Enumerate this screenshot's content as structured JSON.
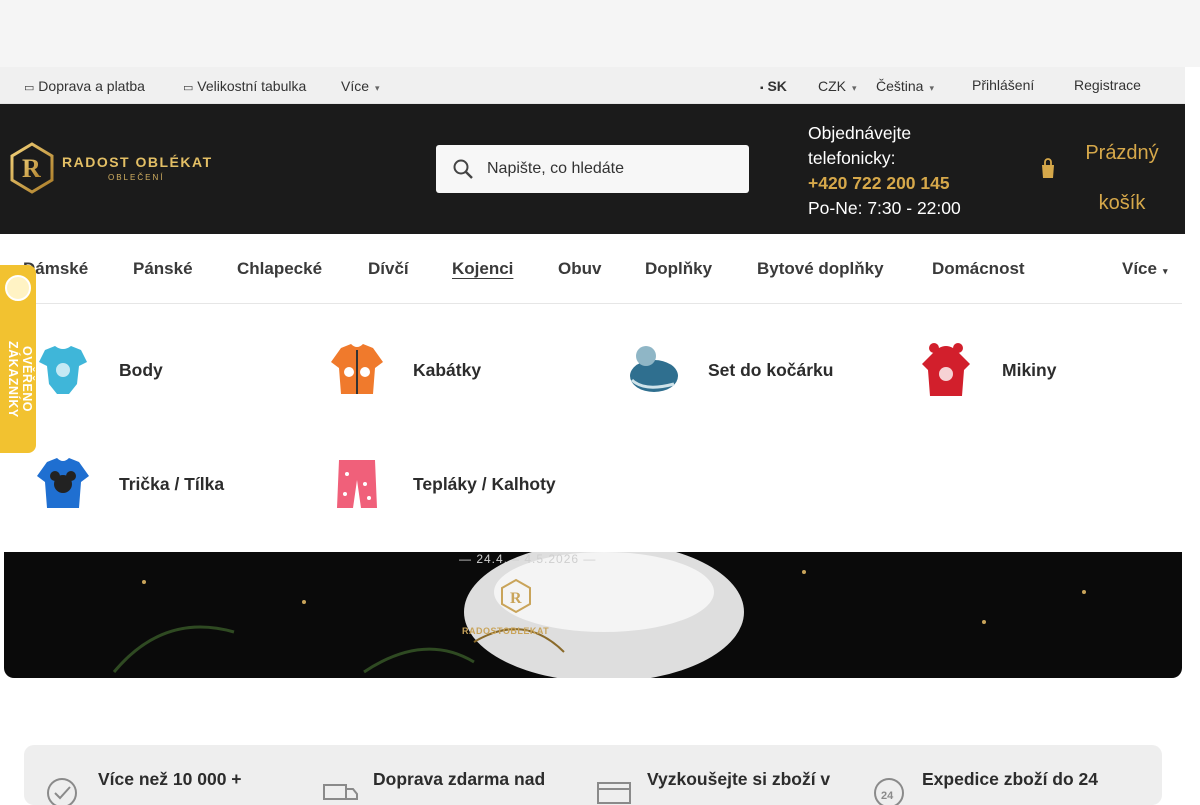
{
  "topbar": {
    "shipping": "Doprava a platba",
    "size_table": "Velikostní tabulka",
    "more": "Více",
    "country": "SK",
    "currency": "CZK",
    "language": "Čeština",
    "login": "Přihlášení",
    "register": "Registrace"
  },
  "header": {
    "logo_text": "RADOST OBLÉKAT",
    "logo_sub": "OBLEČENÍ",
    "search_placeholder": "Napište, co hledáte",
    "contact_line1": "Objednávejte",
    "contact_line2": "telefonicky:",
    "phone": "+420 722 200 145",
    "hours": "Po-Ne: 7:30 - 22:00",
    "cart_line1": "Prázdný",
    "cart_line2": "košík"
  },
  "nav": {
    "items": [
      "Dámské",
      "Pánské",
      "Chlapecké",
      "Dívčí",
      "Kojenci",
      "Obuv",
      "Doplňky",
      "Bytové doplňky",
      "Domácnost"
    ],
    "active": "Kojenci",
    "more": "Více"
  },
  "mega_menu": {
    "categories": [
      {
        "label": "Body",
        "icon": "bodysuit-icon",
        "color": "#3fb6d9"
      },
      {
        "label": "Kabátky",
        "icon": "jacket-icon",
        "color": "#f07a2c"
      },
      {
        "label": "Set do kočárku",
        "icon": "stroller-set-icon",
        "color": "#2f6f8f"
      },
      {
        "label": "Mikiny",
        "icon": "hoodie-icon",
        "color": "#d21f2c"
      },
      {
        "label": "Trička / Tílka",
        "icon": "tshirt-icon",
        "color": "#1f6fd1"
      },
      {
        "label": "Tepláky / Kalhoty",
        "icon": "pants-icon",
        "color": "#f0607a"
      }
    ]
  },
  "banner": {
    "date": "— 24.4. – 4.5.2026 —",
    "brand": "RADOSTOBLEKAT"
  },
  "badge": {
    "text": "OVĚŘENO ZÁKAZNÍKY"
  },
  "features": [
    {
      "label": "Více než 10 000 +",
      "icon": "check-badge-icon"
    },
    {
      "label": "Doprava zdarma nad",
      "icon": "delivery-truck-icon"
    },
    {
      "label": "Vyzkoušejte si zboží v",
      "icon": "store-icon"
    },
    {
      "label": "Expedice zboží do 24",
      "icon": "clock-24-icon"
    }
  ]
}
